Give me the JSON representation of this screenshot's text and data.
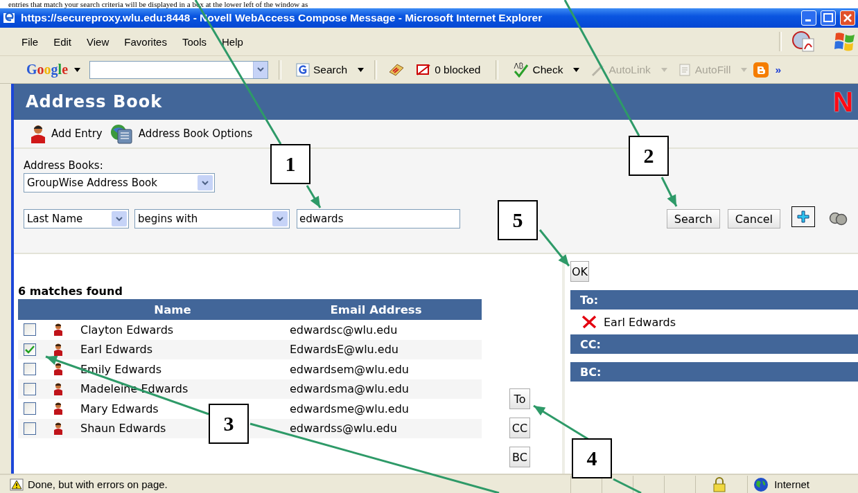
{
  "document_text": "entries that match your search criteria will be displayed in a box at the lower left of the window as",
  "window": {
    "title": "https://secureproxy.wlu.edu:8448 - Novell WebAccess Compose Message - Microsoft Internet Explorer"
  },
  "menu": [
    "File",
    "Edit",
    "View",
    "Favorites",
    "Tools",
    "Help"
  ],
  "google_toolbar": {
    "logo": "Google",
    "items": [
      {
        "kind": "button",
        "label": "Search",
        "disabled": false
      },
      {
        "kind": "blocked",
        "label": "0 blocked",
        "disabled": false
      },
      {
        "kind": "check",
        "label": "Check",
        "disabled": false
      },
      {
        "kind": "autolink",
        "label": "AutoLink",
        "disabled": true
      },
      {
        "kind": "autofill",
        "label": "AutoFill",
        "disabled": true
      }
    ],
    "more": "»"
  },
  "address_book": {
    "title": "Address Book",
    "logo": "N",
    "toolbar": [
      {
        "kind": "person",
        "label": "Add Entry"
      },
      {
        "kind": "book",
        "label": "Address Book Options"
      }
    ],
    "books_label": "Address Books:",
    "book_select": "GroupWise Address Book",
    "field_select": "Last Name",
    "operator_select": "begins with",
    "query": "edwards",
    "buttons": [
      "Search",
      "Cancel"
    ],
    "results_count": "6 matches found",
    "columns": [
      "Name",
      "Email Address"
    ],
    "rows": [
      {
        "name": "Clayton Edwards",
        "email": "edwardsc@wlu.edu",
        "checked": false
      },
      {
        "name": "Earl Edwards",
        "email": "EdwardsE@wlu.edu",
        "checked": true
      },
      {
        "name": "Emily Edwards",
        "email": "edwardsem@wlu.edu",
        "checked": false
      },
      {
        "name": "Madeleine Edwards",
        "email": "edwardsma@wlu.edu",
        "checked": false
      },
      {
        "name": "Mary Edwards",
        "email": "edwardsme@wlu.edu",
        "checked": false
      },
      {
        "name": "Shaun Edwards",
        "email": "edwardss@wlu.edu",
        "checked": false
      }
    ],
    "add_buttons": [
      "To",
      "CC",
      "BC"
    ],
    "ok": "OK",
    "recipients": [
      {
        "label": "To:",
        "names": [
          "Earl Edwards"
        ]
      },
      {
        "label": "CC:"
      },
      {
        "label": "BC:"
      }
    ]
  },
  "status_bar": {
    "text": "Done, but with errors on page.",
    "zone": "Internet"
  },
  "callouts": [
    "1",
    "2",
    "3",
    "4",
    "5"
  ]
}
